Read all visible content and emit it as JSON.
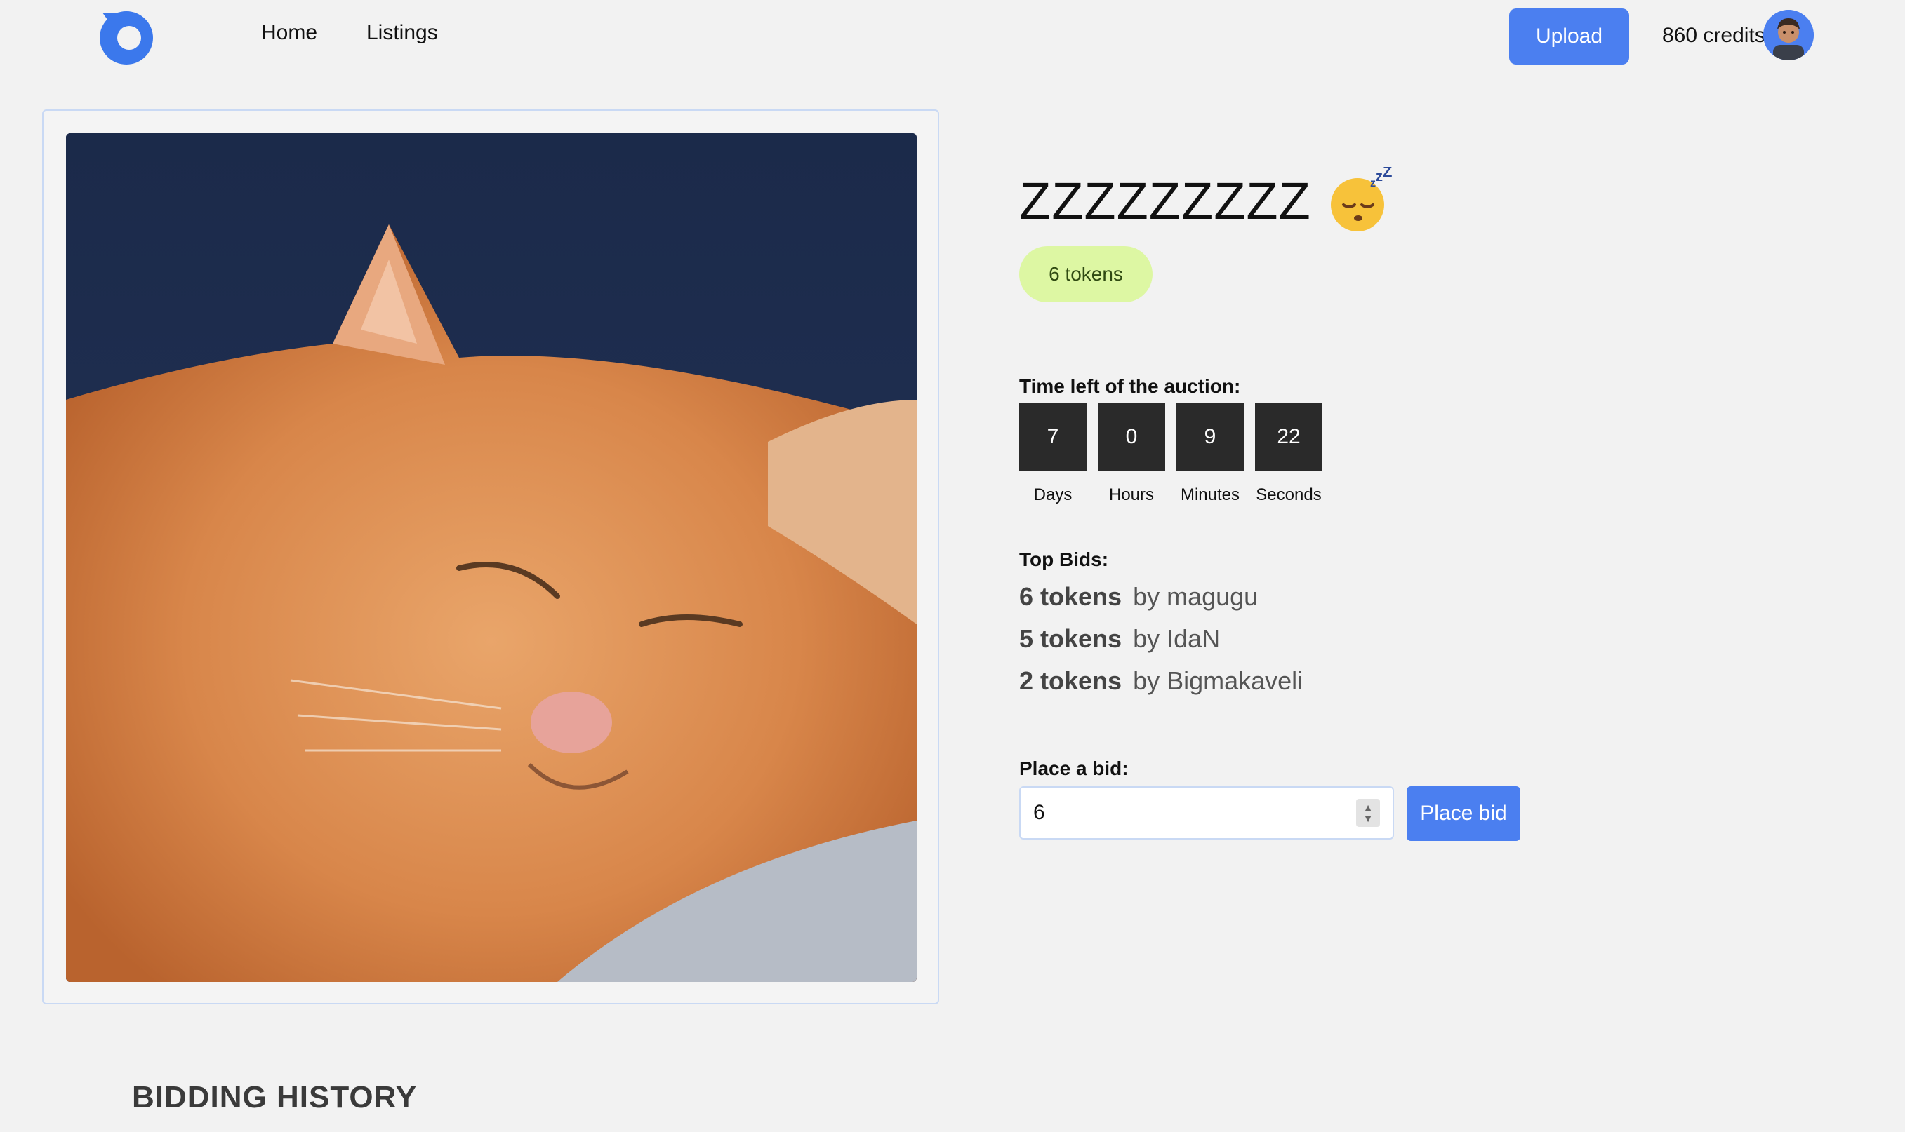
{
  "nav": {
    "home": "Home",
    "listings": "Listings",
    "upload": "Upload",
    "credits": "860 credits"
  },
  "listing": {
    "title": "ZZZZZZZZZ",
    "price": "6 tokens"
  },
  "countdown": {
    "label": "Time left of the auction:",
    "units": [
      {
        "value": "7",
        "label": "Days"
      },
      {
        "value": "0",
        "label": "Hours"
      },
      {
        "value": "9",
        "label": "Minutes"
      },
      {
        "value": "22",
        "label": "Seconds"
      }
    ]
  },
  "top_bids": {
    "label": "Top Bids:",
    "items": [
      {
        "amount": "6 tokens",
        "by": "by magugu"
      },
      {
        "amount": "5 tokens",
        "by": "by IdaN"
      },
      {
        "amount": "2 tokens",
        "by": "by Bigmakaveli"
      }
    ]
  },
  "bid_form": {
    "label": "Place a bid:",
    "value": "6",
    "button": "Place bid"
  },
  "history": {
    "title": "BIDDING HISTORY"
  },
  "colors": {
    "accent": "#4b7ff0",
    "pill": "#ddf7a3",
    "countdown": "#2a2a2a",
    "background": "#f2f2f2"
  },
  "icons": {
    "logo": "logo-icon",
    "avatar": "avatar",
    "emoji": "sleeping-face-icon"
  }
}
